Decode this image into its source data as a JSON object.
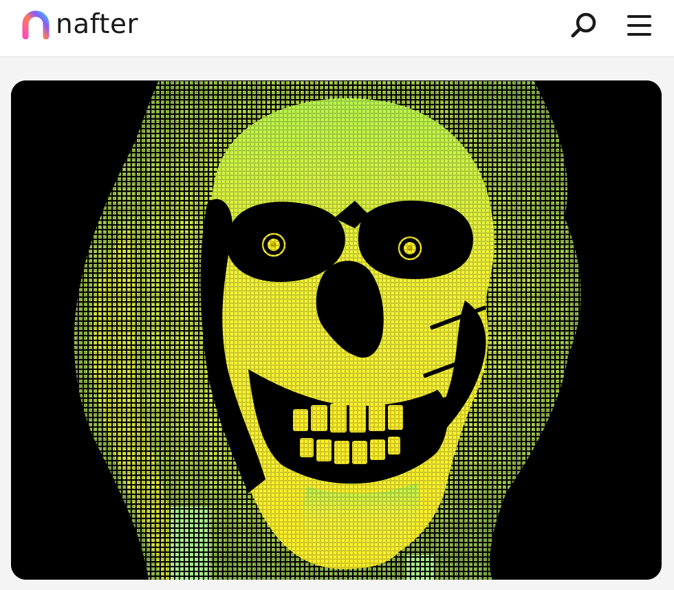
{
  "header": {
    "brand_name": "nafter",
    "logo_icon": "nafter-logo-icon",
    "search_icon": "search-icon",
    "menu_icon": "hamburger-menu-icon"
  },
  "main": {
    "artwork_icon": "skull-artwork",
    "colors": {
      "artwork_background": "#000000",
      "skull_yellow": "#fff22a",
      "skull_green": "#bff54a",
      "page_background": "#f4f4f4"
    }
  }
}
